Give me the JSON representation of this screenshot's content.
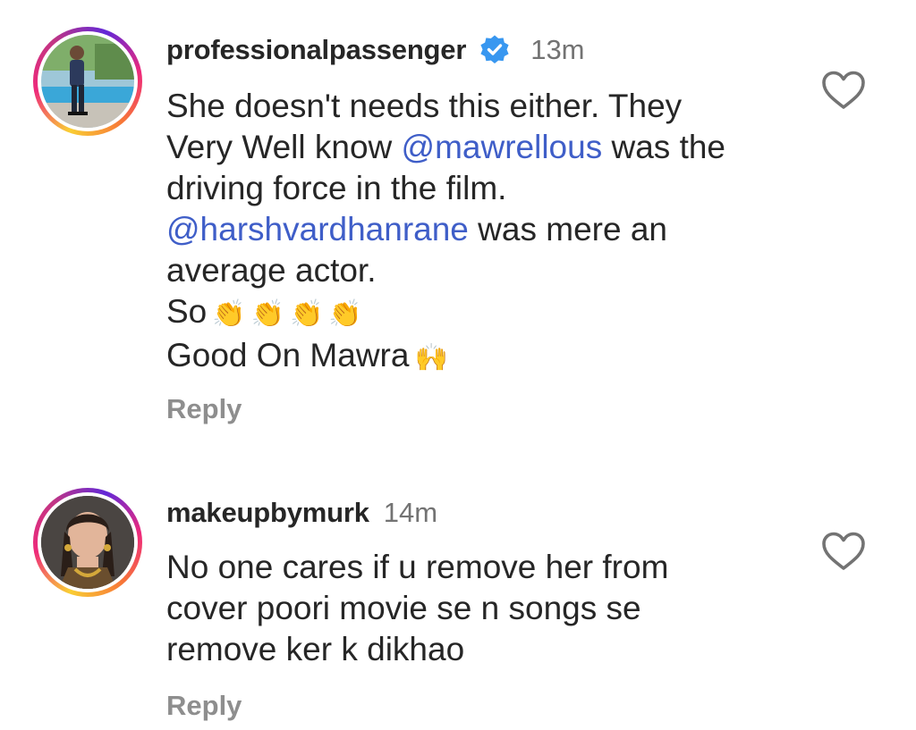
{
  "comments": [
    {
      "username": "professionalpassenger",
      "verified": true,
      "time": "13m",
      "lines": {
        "l1": "She doesn't needs this either. They",
        "l2_pre": "Very Well know ",
        "l2_mention": "@mawrellous",
        "l2_post": " was the",
        "l3": "driving force in the film.",
        "l4_mention": "@harshvardhanrane",
        "l4_post": " was mere an",
        "l5": "average actor.",
        "l6": "So",
        "l7": "Good On Mawra"
      },
      "emoji": {
        "clap": "👏",
        "raised_hands": "🙌"
      },
      "reply_label": "Reply",
      "like_icon": "heart-outline-icon"
    },
    {
      "username": "makeupbymurk",
      "verified": false,
      "time": "14m",
      "lines": {
        "l1": "No one cares if u remove her from",
        "l2": "cover poori movie se n songs se",
        "l3": "remove ker k dikhao"
      },
      "reply_label": "Reply",
      "like_icon": "heart-outline-icon"
    }
  ],
  "colors": {
    "mention": "#3f5ec8",
    "verified_badge": "#3897f0",
    "muted": "#737373",
    "reply": "#8e8e8e",
    "text": "#262626"
  }
}
